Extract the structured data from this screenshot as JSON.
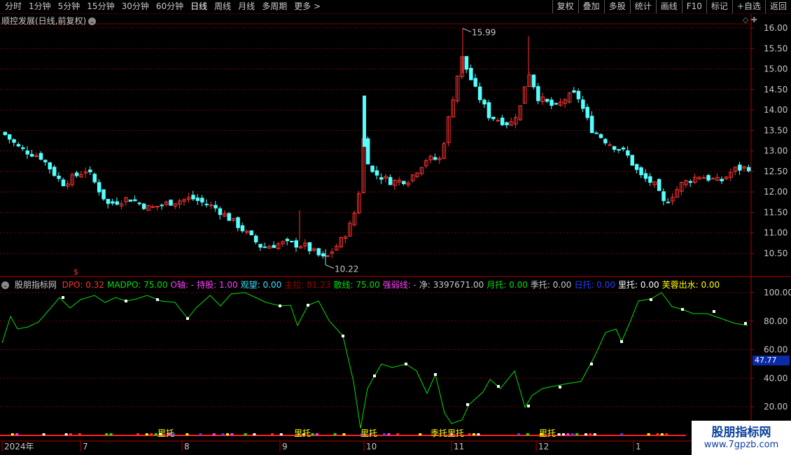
{
  "toolbar": {
    "periods": [
      "分时",
      "1分钟",
      "5分钟",
      "15分钟",
      "30分钟",
      "60分钟",
      "日线",
      "周线",
      "月线",
      "多周期",
      "更多 >"
    ],
    "active_period": "日线",
    "right_buttons": [
      "复权",
      "叠加",
      "多股",
      "统计",
      "画线",
      "F10",
      "标记",
      "+自选",
      "返回"
    ]
  },
  "chart": {
    "title": "顺控发展(日线,前复权)",
    "high_label": "15.99",
    "low_label": "10.22",
    "y_ticks": [
      "16.00",
      "15.50",
      "15.00",
      "14.50",
      "14.00",
      "13.50",
      "13.00",
      "12.50",
      "12.00",
      "11.50",
      "11.00",
      "10.50"
    ],
    "up_color": "#ff3232",
    "down_color": "#54ffff"
  },
  "indicator": {
    "name": "股朋指标网",
    "fields": [
      {
        "label": "DPO: 0.32",
        "color": "#ff3030"
      },
      {
        "label": "MADPO: 75.00",
        "color": "#00e000"
      },
      {
        "label": "O轴: -",
        "color": "#ff40ff"
      },
      {
        "label": "持股: 1.00",
        "color": "#ff40ff"
      },
      {
        "label": "观望: 0.00",
        "color": "#40e0ff"
      },
      {
        "label": "主拉: 81.23",
        "color": "#a00000"
      },
      {
        "label": "散线: 75.00",
        "color": "#00e000"
      },
      {
        "label": "强弱线: -",
        "color": "#ff40ff"
      },
      {
        "label": "净: 3397671.00",
        "color": "#c8c8c8"
      },
      {
        "label": "月托: 0.00",
        "color": "#00e000"
      },
      {
        "label": "季托: 0.00",
        "color": "#c8c8c8"
      },
      {
        "label": "日托: 0.00",
        "color": "#2040ff"
      },
      {
        "label": "里托: 0.00",
        "color": "#ffffff"
      },
      {
        "label": "芙蓉出水: 0.00",
        "color": "#ffff00"
      }
    ],
    "y_ticks": [
      "100.00",
      "80.00",
      "60.00",
      "40.00",
      "20.00"
    ],
    "current_value": "47.77",
    "markers": [
      "里托",
      "里托",
      "里托",
      "季托里托",
      "里托"
    ],
    "signal_mark": "$",
    "line_color": "#00e000"
  },
  "x_axis": {
    "labels": [
      "2024年",
      "7",
      "8",
      "9",
      "10",
      "11",
      "12",
      "1"
    ]
  },
  "watermark": {
    "title": "股朋指标网",
    "url": "www.7gpzb.com"
  }
}
